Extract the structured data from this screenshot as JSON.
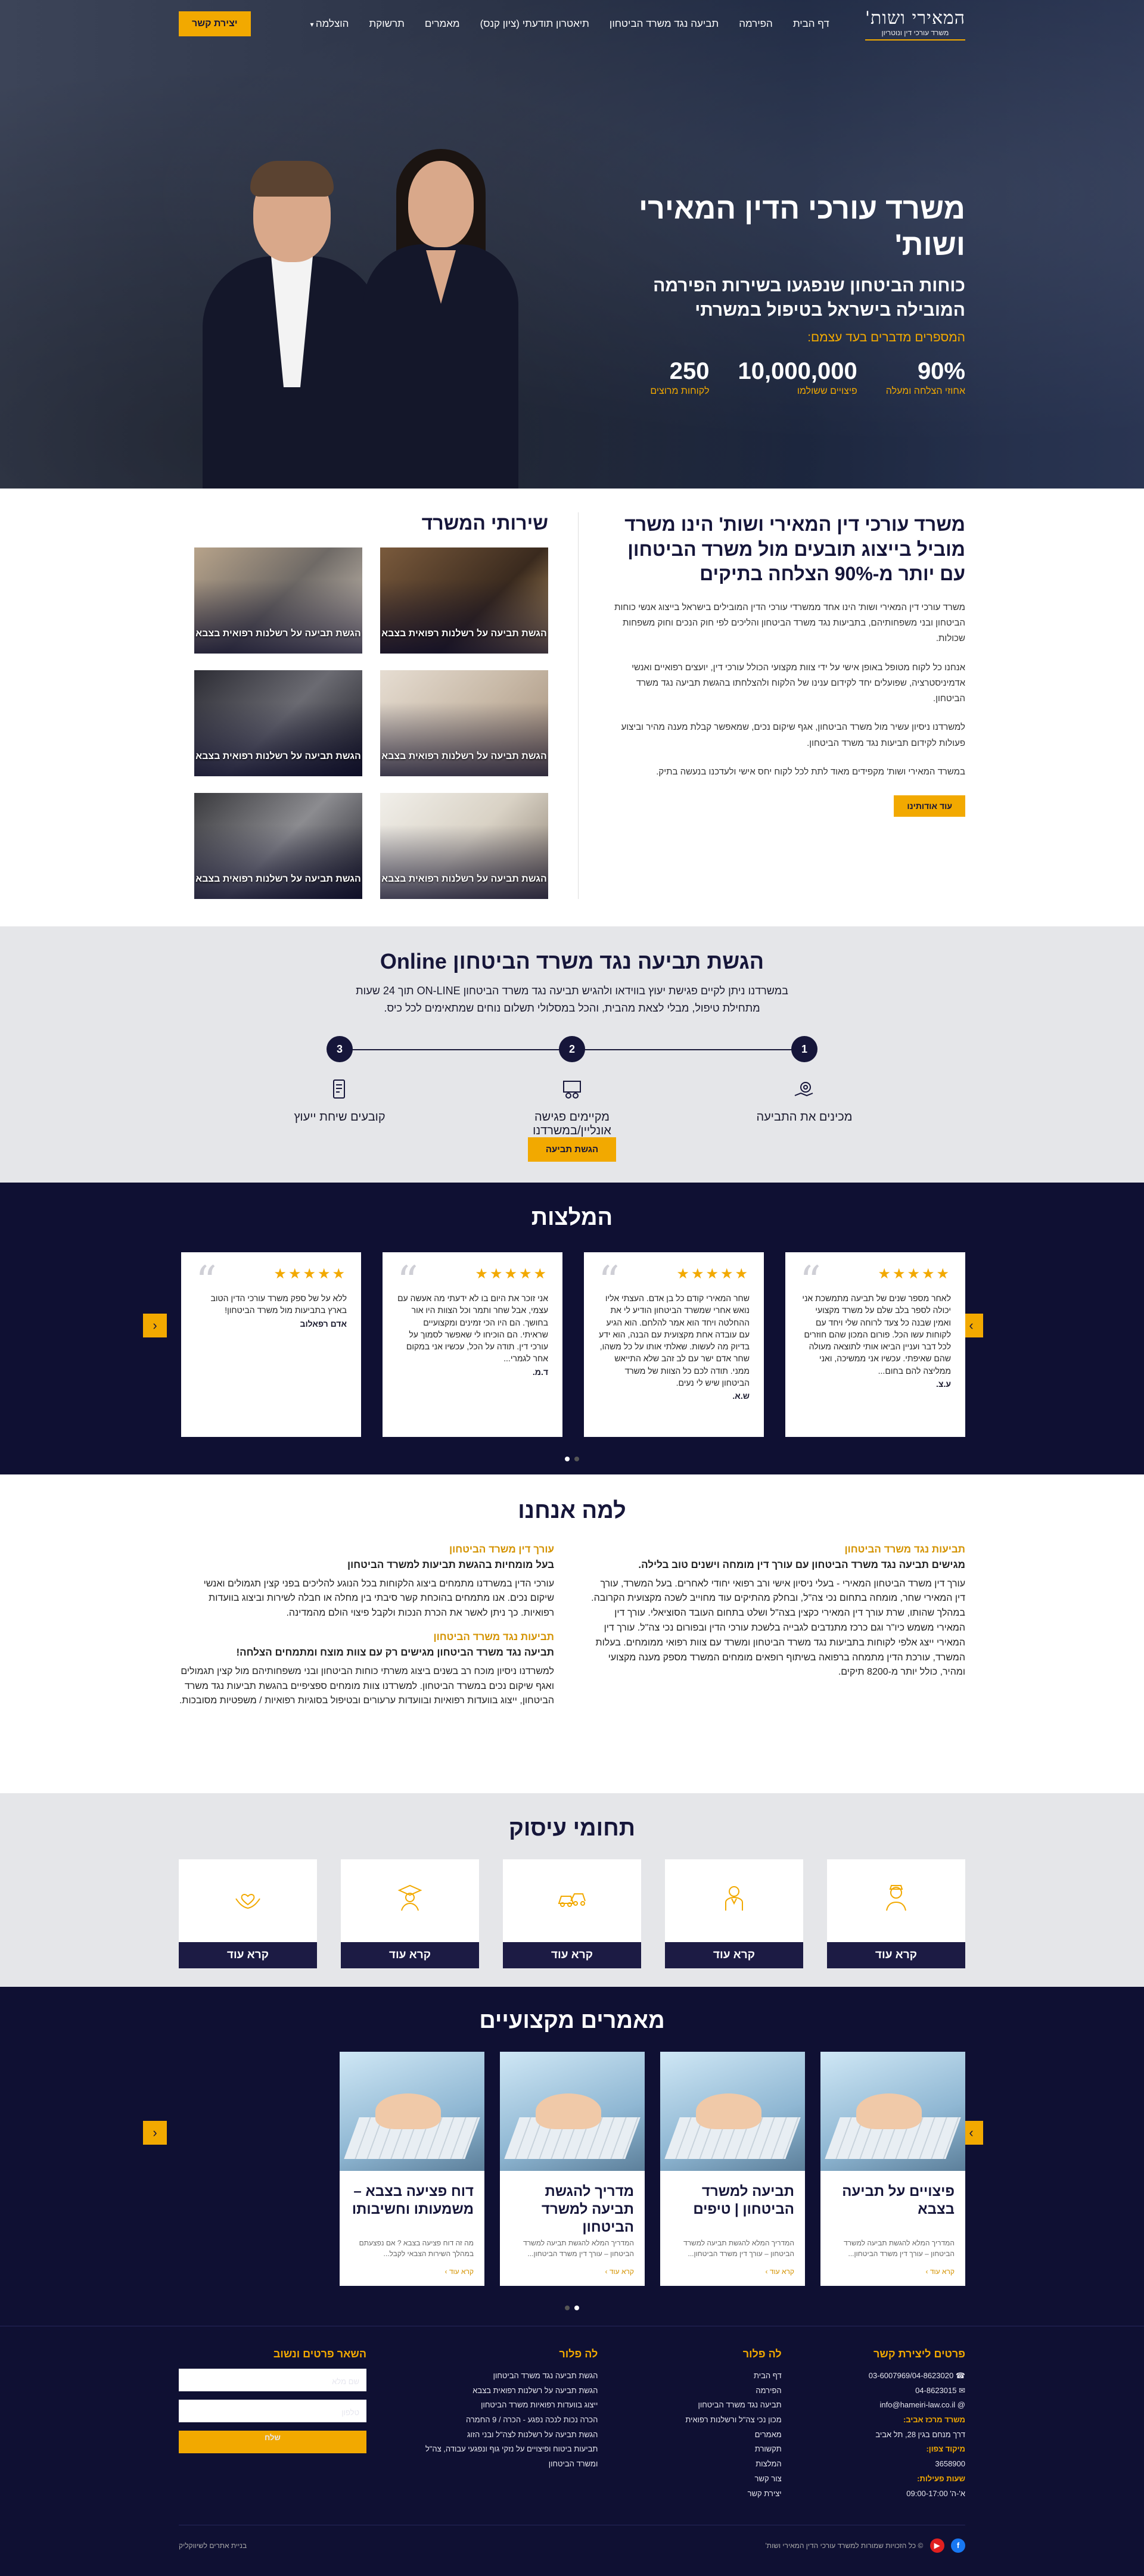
{
  "header": {
    "logo_title": "המאירי ושות'",
    "logo_subtitle": "משרד עורכי דין ונוטריון",
    "nav": [
      "דף הבית",
      "הפירמה",
      "תביעה נגד משרד הביטחון",
      "תיאטרון תודעתי (ציון קנס)",
      "מאמרים",
      "תרשוקת",
      "הוצלמה"
    ],
    "contact_button": "יצירת קשר"
  },
  "hero": {
    "title": "משרד עורכי הדין המאירי ושות'",
    "subtitle": "כוחות הביטחון שנפגעו בשירות הפירמה המובילה בישראל בטיפול במשרתי",
    "caption": "המספרים מדברים בעד עצמם:",
    "stats": [
      {
        "value": "90%",
        "label": "אחוזי הצלחה ומעלה"
      },
      {
        "value": "10,000,000",
        "label": "פיצויים ששולמו"
      },
      {
        "value": "250",
        "label": "לקוחות מרוצים"
      }
    ]
  },
  "about": {
    "title": "משרד עורכי דין המאירי ושות' הינו משרד מוביל בייצוג תובעים מול משרד הביטחון עם יותר מ-90% הצלחה בתיקים",
    "paragraphs": [
      "משרד עורכי דין המאירי ושות' הינו אחד ממשרדי עורכי הדין המובילים בישראל בייצוג אנשי כוחות הביטחון ובני משפחותיהם, בתביעות נגד משרד הביטחון והליכים לפי חוק הנכים וחוק משפחות שכולות.",
      "אנחנו כל לקוח מטופל באופן אישי על ידי צוות מקצועי הכולל עורכי דין, יועצים רפואיים ואנשי אדמיניסטרציה, שפועלים יחד לקידום ענינו של הלקוח ולהצלחתו בהגשת תביעה נגד משרד הביטחון.",
      "למשרדנו ניסיון עשיר מול משרד הביטחון, אגף שיקום נכים, שמאפשר קבלת מענה מהיר וביצוע פעולות לקידום תביעות נגד משרד הביטחון.",
      "במשרד המאירי ושות' מקפידים מאוד לתת לכל לקוח יחס אישי ולעדכנו בנעשה בתיק."
    ],
    "button": "עוד אודותינו"
  },
  "services": {
    "title": "שירותי המשרד",
    "items": [
      "הגשת תביעה על רשלנות רפואית בצבא",
      "הגשת תביעה על רשלנות רפואית בצבא",
      "הגשת תביעה על רשלנות רפואית בצבא",
      "הגשת תביעה על רשלנות רפואית בצבא",
      "הגשת תביעה על רשלנות רפואית בצבא",
      "הגשת תביעה על רשלנות רפואית בצבא"
    ]
  },
  "claim": {
    "title": "הגשת תביעה נגד משרד הביטחון Online",
    "text": "במשרדנו ניתן לקיים פגישת יעוץ בווידאו ולהגיש תביעה נגד משרד הביטחון ON-LINE תוך 24 שעות מתחילת טיפול, מבלי לצאת מהבית, והכל במסלולי תשלום נוחים שמתאימים לכל כיס.",
    "steps": [
      {
        "num": "1",
        "label": "מכינים את התביעה"
      },
      {
        "num": "2",
        "label": "מקיימים פגישה אונליין/במשרדנו"
      },
      {
        "num": "3",
        "label": "קובעים שיחת ייעוץ"
      }
    ],
    "button": "הגשת תביעה"
  },
  "testimonials": {
    "title": "המלצות",
    "items": [
      {
        "stars": "★★★★★",
        "text": "לאחר מספר שנים של תביעה מתמשכת אני יכולה לספר בלב שלם על משרד מקצועי ואמין שבנה כל צעד לרוחה שלי ויחד עם לקוחות עשו הכל. פורום המכון שהם חוזרים לכל דבר ועניין הביאו אותי לתוצאה מעולה שהם שאיפתי. עכשיו אני ממשיכה, ואני ממליצה להם בחום...",
        "author": "ע.צ."
      },
      {
        "stars": "★★★★★",
        "text": "שחר המאירי קודם כל בן אדם. העצתי אליו נואש אחרי שמשרד הביטחון הודיע לי את ההחלטה ויחד הוא אמר להלחם. הוא הגיע עם עובדה אחת מקצועית עם הבנה, הוא ידע בדיוק מה לעשות. שאלתי אותו על כל משהו, שחר אדם ישר עם לב זהב שלא התייאש ממני. תודה לכם כל הצוות של משרד הביטחון שיש לי נעים.",
        "author": "ש.א."
      },
      {
        "stars": "★★★★★",
        "text": "אני זוכר את היום בו לא ידעתי מה אעשה עם עצמי, אבל שחר ותמר וכל הצוות היו אור בחושך. הם היו הכי זמינים ומקצועיים שראיתי. הם הוכיחו לי שאפשר לסמוך על עורכי דין. תודה על הכל, עכשיו אני במקום אחר לגמרי...",
        "author": "ד.מ."
      },
      {
        "stars": "★★★★★",
        "text": "ללא על של ספק משרד עורכי הדין הטוב בארץ בתביעות מול משרד הביטחון!",
        "author": "אדם רפאלוב"
      }
    ]
  },
  "why": {
    "title": "למה אנחנו",
    "right": [
      {
        "kicker": "תביעות נגד משרד הביטחון",
        "heading": "מגישים תביעה נגד משרד הביטחון עם עורך דין מומחה וישנים טוב בלילה.",
        "text": "עורך דין משרד הביטחון המאירי - בעלי ניסיון אישי ורב רפואי יחודי לאחרים. בעל המשרד, עורך דין המאירי שחר, מומחה בתחום נכי צה\"ל, ובחלק מהתיקים עוד מחוייב לשכה מקצועית הקרובה. במהלך שהותו, שרת עורך דין המאירי כקצין בצה\"ל ושלט בתחום העובד הסוציאלי. עורך דין המאירי משמש כיו\"ר וגם כרכז מתנדבים לגבייה בלשכת עורכי הדין ובפורום נכי צה\"ל. עורך דין המאירי ייצג אלפי לקוחות בתביעות נגד משרד הביטחון ומשרד עם צוות רפואי ממומחים. בעלות המשרד, עורכת הדין מתמחה ברפואה בשיתוף רופאים מומחים המשרד מספק מענה מקצועי ומהיר, כולל יותר מ-8200 תיקים."
      },
      {
        "kicker": "",
        "heading": "",
        "text": ""
      }
    ],
    "left": [
      {
        "kicker": "עורך דין משרד הביטחון",
        "heading": "בעל מומחיות בהגשת תביעות למשרד הביטחון",
        "text": "עורכי הדין במשרדנו מתמחים ביצוג הלקוחות בכל הנוגע להליכים בפני קצין תגמולים ואנשי שיקום נכים. אנו מתמחים בהוכחת קשר סיבתי בין מחלה או חבלה לשירות וביצוג בוועדות רפואיות. כך ניתן לאשר את הכרת הנכות ולקבל פיצוי הולם מהמדינה."
      },
      {
        "kicker": "תביעות נגד משרד הביטחון",
        "heading": "תביעה נגד משרד הביטחון מגישים רק עם צוות מוצח ומתמחים הצלחה!",
        "text": "למשרדנו ניסיון מוכח רב בשנים ביצוג משרתי כוחות הביטחון ובני משפחותיהם מול קצין תגמולים ואגף שיקום נכים במשרד הביטחון. למשרדנו צוות מומחים ספציפיים בהגשת תביעות נגד משרד הביטחון, ייצוג בוועדות רפואיות ובוועדות ערעורים ובטיפול בסוגיות רפואיות / משפטיות מסובכות."
      }
    ]
  },
  "practice": {
    "title": "תחומי עיסוק",
    "button": "קרא עוד",
    "icons": [
      "soldier-icon",
      "officer-icon",
      "car-crash-icon",
      "graduate-icon",
      "hands-heart-icon"
    ]
  },
  "articles": {
    "title": "מאמרים מקצועיים",
    "read_more": "קרא עוד",
    "items": [
      {
        "title": "פיצויים על תביעה בצבא",
        "excerpt": "המדריך המלא להגשת תביעה למשרד הביטחון – עורך דין משרד הביטחון..."
      },
      {
        "title": "תביעה למשרד הביטחון | טיפים",
        "excerpt": "המדריך המלא להגשת תביעה למשרד הביטחון – עורך דין משרד הביטחון..."
      },
      {
        "title": "מדריך להגשת תביעה למשרד הביטחון",
        "excerpt": "המדריך המלא להגשת תביעה למשרד הביטחון – עורך דין משרד הביטחון..."
      },
      {
        "title": "דוח פציעה בצבא – משמעותו וחשיבותו",
        "excerpt": "מה זה דוח פציעה בצבא ? אם נפצעתם במהלך השירות הצבאי לקבל..."
      }
    ]
  },
  "footer": {
    "contact_title": "פרטים ליצירת קשר",
    "contact_lines": [
      "03-6007969/04-8623020",
      "04-8623015",
      "info@hameiri-law.co.il"
    ],
    "office_title": "משרד מרכז אביב:",
    "office_addr": "דרך מנחם בגין 28, תל אביב",
    "zip_title": "מיקוד צפון:",
    "zip": "3658900",
    "hours_title": "שעות פעילות:",
    "hours": "א'-ה' 09:00-17:00",
    "nav1_title": "לה פלור",
    "nav1": [
      "דף הבית",
      "הפירמה",
      "תביעה נגד משרד הביטחון",
      "מכון נכי צה\"ל ורשלנות רפואית",
      "מאמרים",
      "תקשורת",
      "המלצות",
      "צור קשר",
      "יצירת קשר"
    ],
    "nav2_title": "לה פלור",
    "nav2": [
      "הגשת תביעה נגד משרד הביטחון",
      "הגשת תביעה על רשלנות רפואית בצבא",
      "ייצוג בוועדות רפואיות משרד הביטחון",
      "הכרה נכות לנכה נפגע - הכרה / 9 החמרה",
      "הגשת תביעה על רשלנות לצה\"ל ובני הזוג",
      "תביעות ביטוח ופיצויים על נזקי גוף ונפגעי עבודה, צה\"ל ומשרד הביטחון"
    ],
    "form_title": "השאר פרטים ונשוב",
    "name_placeholder": "שם מלא",
    "phone_placeholder": "טלפון",
    "send": "שלח",
    "copyright": "© כל הזכויות שמורות למשרד עורכי הדין המאירי ושות'",
    "credit": "בניית אתרים לשיווקליק"
  }
}
